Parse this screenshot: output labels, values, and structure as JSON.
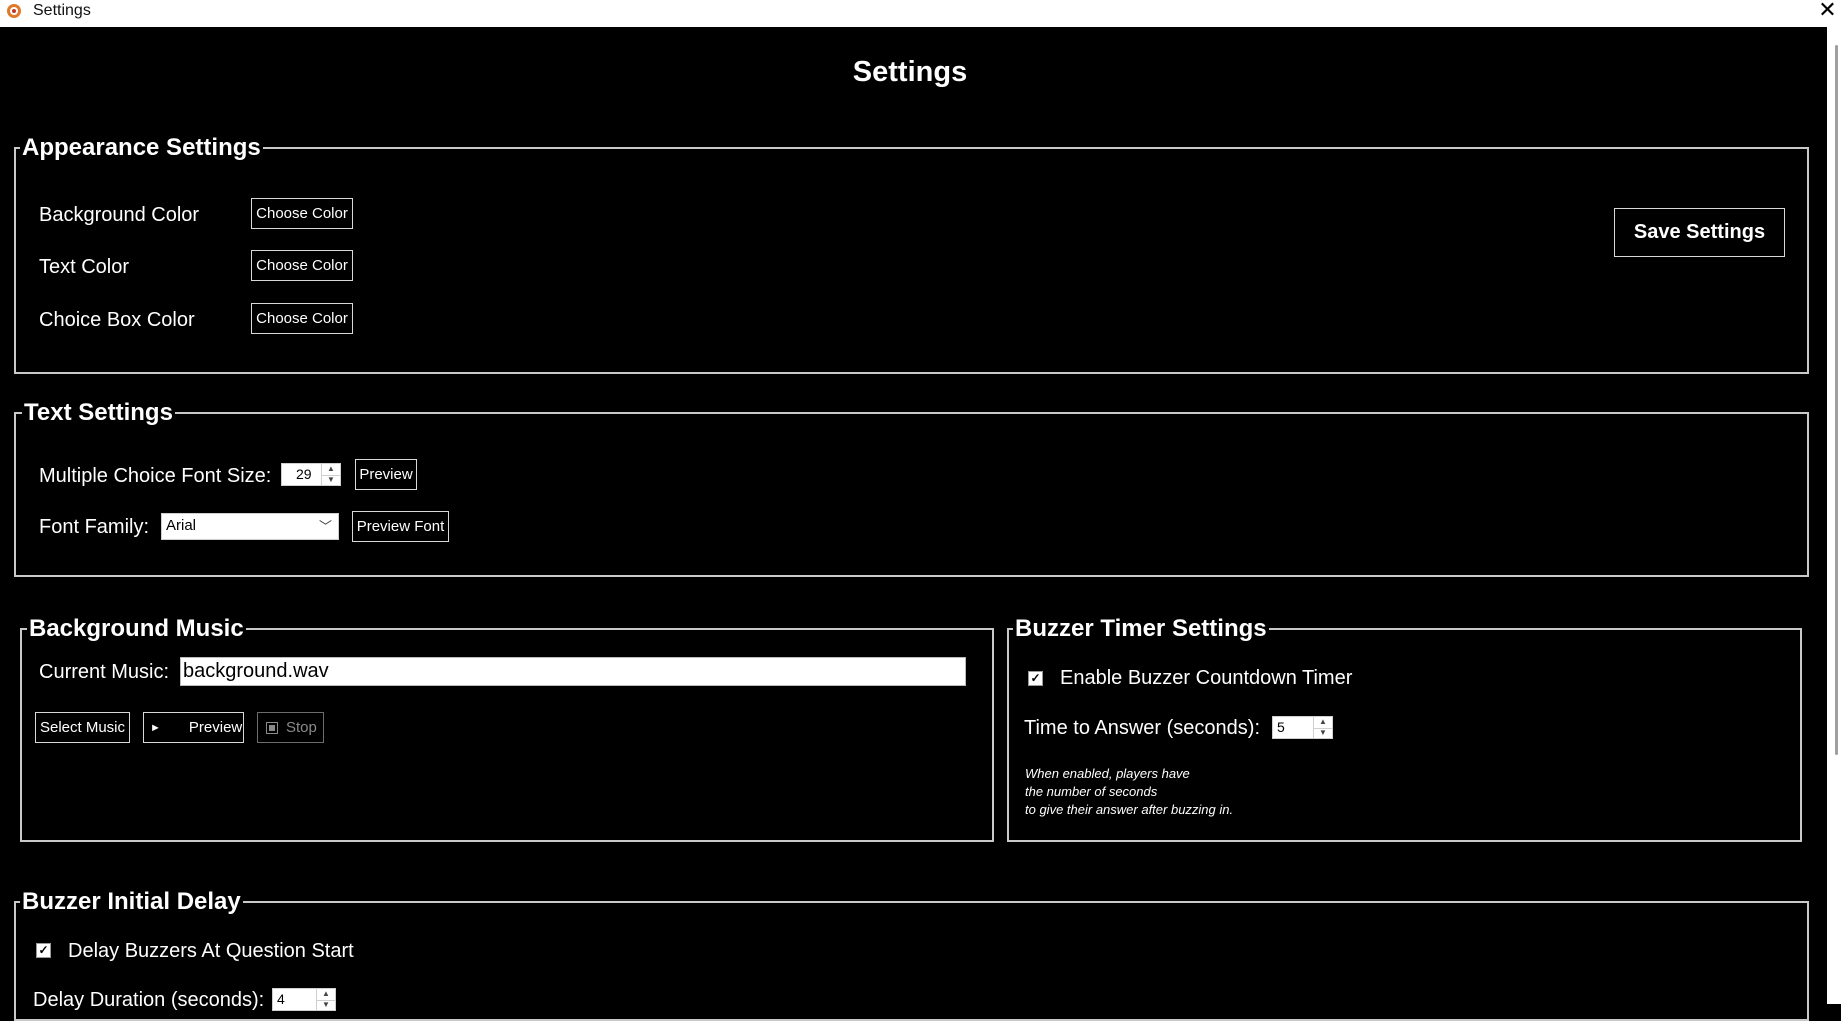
{
  "window": {
    "title": "Settings",
    "close_glyph": "✕",
    "icon": "app-icon"
  },
  "page_title": "Settings",
  "appearance": {
    "legend": "Appearance Settings",
    "rows": [
      {
        "label": "Background Color",
        "button": "Choose Color"
      },
      {
        "label": "Text Color",
        "button": "Choose Color"
      },
      {
        "label": "Choice Box Color",
        "button": "Choose Color"
      }
    ],
    "save_label": "Save Settings"
  },
  "text_settings": {
    "legend": "Text Settings",
    "font_size_label": "Multiple Choice Font Size:",
    "font_size_value": "29",
    "preview_label": "Preview",
    "font_family_label": "Font Family:",
    "font_family_value": "Arial",
    "preview_font_label": "Preview Font"
  },
  "music": {
    "legend": "Background Music",
    "current_label": "Current Music:",
    "current_value": "background.wav",
    "select_label": "Select Music",
    "preview_glyph": "►",
    "preview_label": "Preview",
    "stop_label": "Stop"
  },
  "buzzer_timer": {
    "legend": "Buzzer Timer Settings",
    "enable_label": "Enable Buzzer Countdown Timer",
    "enable_checked": true,
    "time_label": "Time to Answer (seconds):",
    "time_value": "5",
    "note": "When enabled, players have\nthe number of seconds\nto give their answer after buzzing in."
  },
  "initial_delay": {
    "legend": "Buzzer Initial Delay",
    "delay_label": "Delay Buzzers At Question Start",
    "delay_checked": true,
    "duration_label": "Delay Duration (seconds):",
    "duration_value": "4"
  },
  "check_glyph": "✓"
}
